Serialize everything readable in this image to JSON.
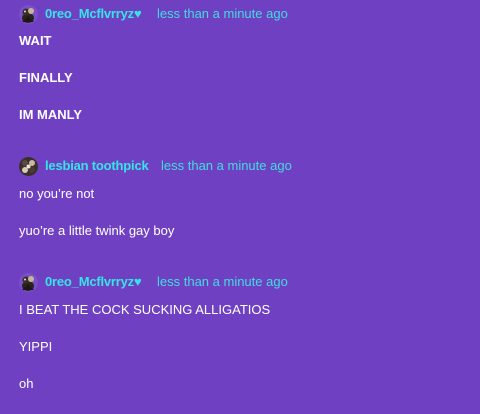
{
  "posts": [
    {
      "username": "0reo_Mcflvrryz♥",
      "timestamp": "less than a minute ago",
      "avatar_icon": "creature-avatar-icon",
      "messages": [
        "WAIT",
        "FINALLY",
        "IM MANLY"
      ]
    },
    {
      "username": "lesbian toothpick",
      "timestamp": "less than a minute ago",
      "avatar_icon": "creature-avatar-icon",
      "messages": [
        "no you’re not",
        "yuo’re a little twink gay boy"
      ]
    },
    {
      "username": "0reo_Mcflvrryz♥",
      "timestamp": "less than a minute ago",
      "avatar_icon": "creature-avatar-icon",
      "messages": [
        "I BEAT THE COCK SUCKING ALLIGATIOS",
        "YIPPI",
        "oh"
      ]
    }
  ],
  "colors": {
    "background": "#6f41c2",
    "username": "#36e4e6",
    "timestamp": "#3fdddf",
    "message": "#ffffff"
  }
}
